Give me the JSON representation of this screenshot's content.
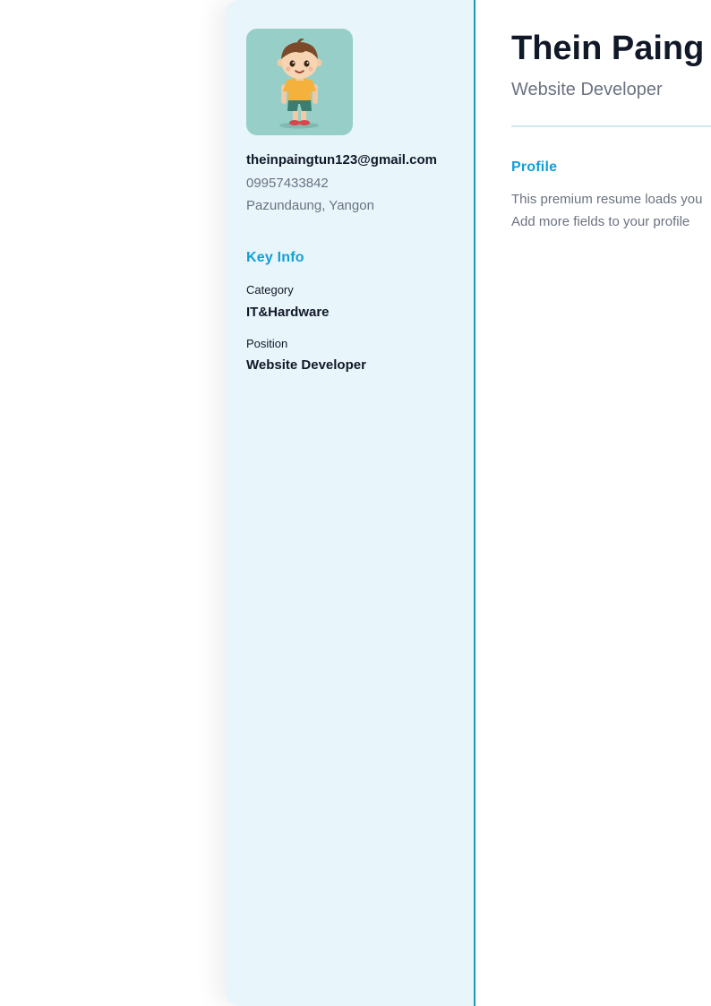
{
  "sidebar": {
    "contact": {
      "email": "theinpaingtun123@gmail.com",
      "phone": "09957433842",
      "location": "Pazundaung, Yangon"
    },
    "key_info": {
      "heading": "Key Info",
      "fields": [
        {
          "label": "Category",
          "value": "IT&Hardware"
        },
        {
          "label": "Position",
          "value": "Website Developer"
        }
      ]
    }
  },
  "main": {
    "name": "Thein Paing",
    "title": "Website Developer",
    "profile": {
      "heading": "Profile",
      "lines": [
        "This premium resume loads you",
        "Add more fields to your profile"
      ]
    }
  },
  "colors": {
    "accent": "#129fd8",
    "sidebar_bg": "#e8f5fb",
    "sidebar_border": "#1c9ba8",
    "avatar_bg": "#97cfc8",
    "text_dark": "#111827",
    "text_muted": "#6b7280"
  }
}
